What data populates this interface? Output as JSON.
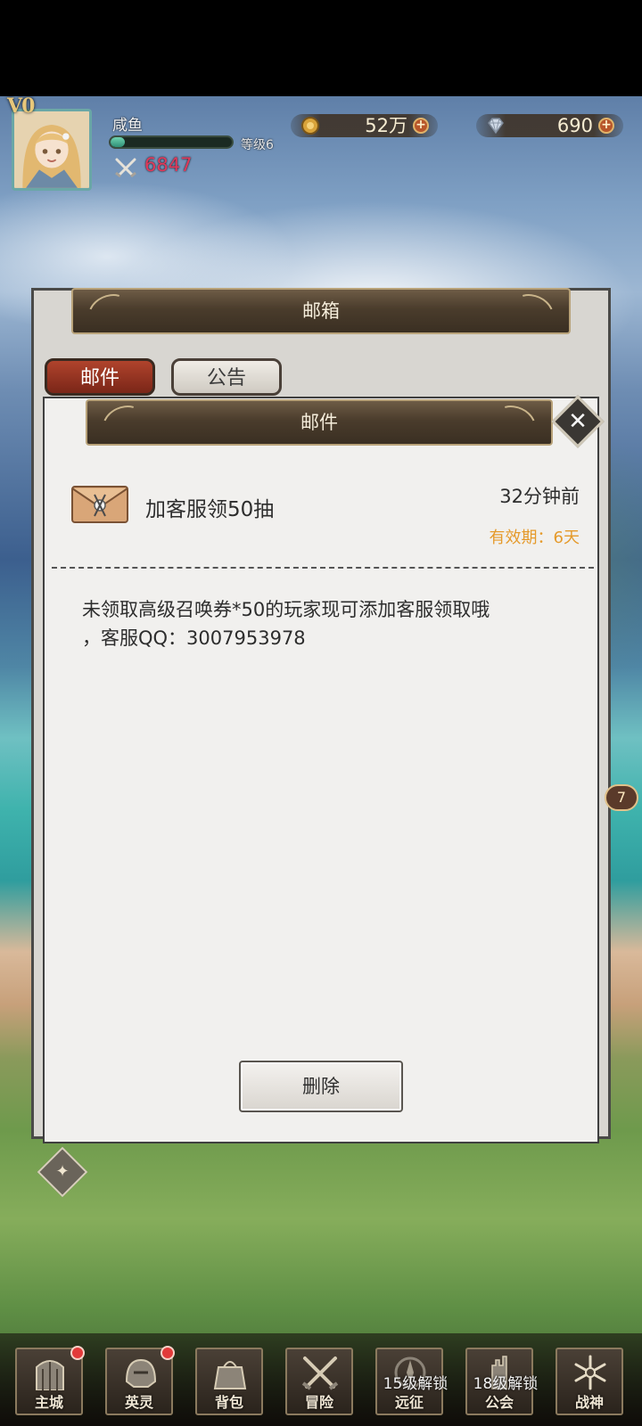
{
  "hud": {
    "vip": "V0",
    "player_name": "咸鱼",
    "level": "等级6",
    "exp_fraction": 0.12,
    "power": "6847",
    "gold": "52万",
    "gems": "690"
  },
  "mailbox": {
    "title": "邮箱",
    "tabs": [
      "邮件",
      "公告"
    ],
    "active_tab": "邮件"
  },
  "mail": {
    "panel_title": "邮件",
    "close": "✕",
    "subject": "加客服领50抽",
    "time": "32分钟前",
    "expiry": "有效期：6天",
    "body_line1": "未领取高级召唤券*50的玩家现可添加客服领取哦",
    "body_line2": "，客服QQ：3007953978",
    "delete_label": "删除"
  },
  "side_badge": "7",
  "nav": {
    "items": [
      {
        "label": "主城",
        "icon": "gate-icon",
        "red_dot": true
      },
      {
        "label": "英灵",
        "icon": "helmet-icon",
        "red_dot": true
      },
      {
        "label": "背包",
        "icon": "bag-icon",
        "red_dot": false
      },
      {
        "label": "冒险",
        "icon": "crossed-swords-icon",
        "red_dot": false
      },
      {
        "label": "远征",
        "icon": "compass-icon",
        "lock": "15级解锁"
      },
      {
        "label": "公会",
        "icon": "castle-icon",
        "lock": "18级解锁"
      },
      {
        "label": "战神",
        "icon": "snowflake-icon",
        "red_dot": false
      }
    ]
  },
  "colors": {
    "tab_active": "#b0432c",
    "expiry": "#e59a2b",
    "power": "#e0395a",
    "notify_dot": "#e23a3a"
  }
}
